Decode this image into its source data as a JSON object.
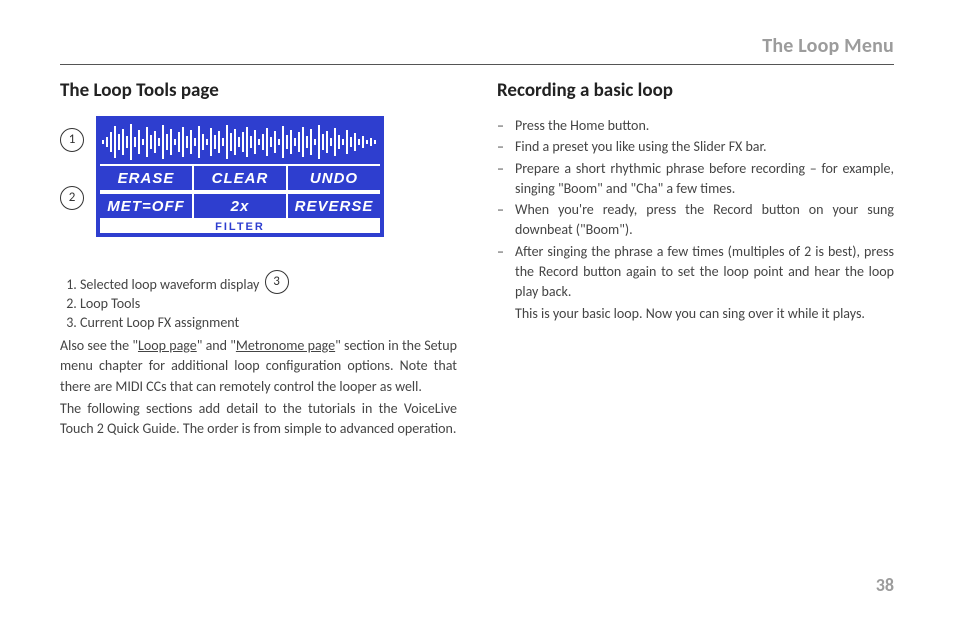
{
  "header": {
    "title": "The Loop Menu"
  },
  "left": {
    "heading": "The Loop Tools page",
    "callouts": {
      "c1": "1",
      "c2": "2",
      "c3": "3"
    },
    "diagram": {
      "row1": [
        "ERASE",
        "CLEAR",
        "UNDO"
      ],
      "row2": [
        "MET=OFF",
        "2x",
        "REVERSE"
      ],
      "filter": "FILTER"
    },
    "legend": [
      "Selected loop waveform display",
      "Loop Tools",
      "Current Loop FX assignment"
    ],
    "para1_a": "Also see the \"",
    "para1_link1": "Loop page",
    "para1_b": "\" and \"",
    "para1_link2": "Metronome page",
    "para1_c": "\" section in the Setup menu chapter for additional loop configuration options. Note that there are MIDI CCs that can remotely control the looper as well.",
    "para2": "The following sections add detail to the tutorials in the VoiceLive Touch 2 Quick Guide. The order is from simple to advanced operation."
  },
  "right": {
    "heading": "Recording a basic loop",
    "steps": [
      "Press the Home button.",
      "Find a preset you like using the Slider FX bar.",
      "Prepare a short rhythmic phrase before recording – for example, singing \"Boom\" and \"Cha\" a few times.",
      "When you're ready, press the Record button on your sung downbeat (\"Boom\").",
      "After singing the phrase a few times (multiples of 2 is best), press the Record button again to set the loop point and hear the loop play back."
    ],
    "trailing": "This is your basic loop. Now you can sing over it while it plays."
  },
  "page_number": "38"
}
